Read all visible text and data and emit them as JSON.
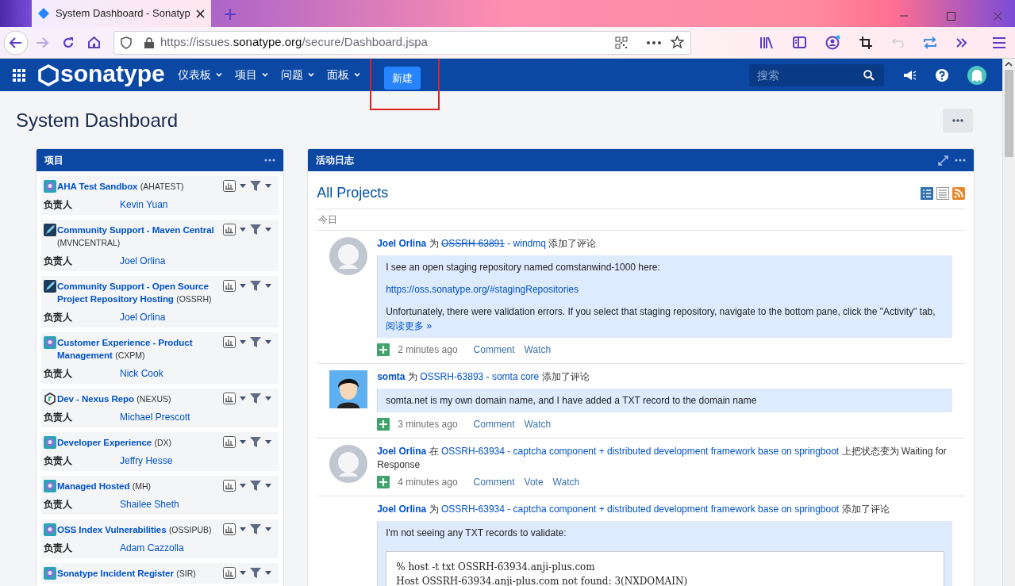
{
  "browser": {
    "tab_title": "System Dashboard - Sonatyp",
    "url": {
      "scheme": "https://issues.",
      "domain": "sonatype.org",
      "path": "/secure/Dashboard.jspa"
    }
  },
  "header": {
    "logo": "sonatype",
    "nav": [
      {
        "label": "仪表板"
      },
      {
        "label": "项目"
      },
      {
        "label": "问题"
      },
      {
        "label": "面板"
      }
    ],
    "create_button": {
      "label": "新建",
      "highlighted": true
    },
    "search": {
      "placeholder": "搜索"
    }
  },
  "page_title": "System Dashboard",
  "projects_gadget": {
    "title": "项目",
    "projects": [
      {
        "kind": "bot",
        "name": "AHA Test Sandbox",
        "key": "(AHATEST)",
        "lead_label": "负责人",
        "lead": "Kevin Yuan"
      },
      {
        "kind": "rocket",
        "name": "Community Support - Maven Central",
        "key": "(MVNCENTRAL)",
        "lead_label": "负责人",
        "lead": "Joel Orlina"
      },
      {
        "kind": "rocket",
        "name": "Community Support - Open Source Project Repository Hosting",
        "key": "(OSSRH)",
        "lead_label": "负责人",
        "lead": "Joel Orlina"
      },
      {
        "kind": "bot",
        "name": "Customer Experience - Product Management",
        "key": "(CXPM)",
        "lead_label": "负责人",
        "lead": "Nick Cook"
      },
      {
        "kind": "hexagon",
        "name": "Dev - Nexus Repo",
        "key": "(NEXUS)",
        "lead_label": "负责人",
        "lead": "Michael Prescott"
      },
      {
        "kind": "bot",
        "name": "Developer Experience",
        "key": "(DX)",
        "lead_label": "负责人",
        "lead": "Jeffry Hesse"
      },
      {
        "kind": "bot",
        "name": "Managed Hosted",
        "key": "(MH)",
        "lead_label": "负责人",
        "lead": "Shailee Sheth"
      },
      {
        "kind": "bot",
        "name": "OSS Index Vulnerabilities",
        "key": "(OSSIPUB)",
        "lead_label": "负责人",
        "lead": "Adam Cazzolla"
      },
      {
        "kind": "bot",
        "name": "Sonatype Incident Register",
        "key": "(SIR)"
      }
    ]
  },
  "activity_gadget": {
    "title": "活动日志",
    "heading": "All Projects",
    "day": "今日",
    "entries": [
      {
        "kind": "default",
        "actor": "Joel Orlina",
        "connector": "为",
        "issue_key": "OSSRH-63891",
        "resolved": true,
        "issue_summary": "- windmq",
        "action": "添加了评论",
        "comment": [
          {
            "kind": "text",
            "text": "I see an open staging repository named comstanwind-1000 here:"
          },
          {
            "kind": "link",
            "text": "https://oss.sonatype.org/#stagingRepositories"
          },
          {
            "kind": "text",
            "text": "Unfortunately, there were validation errors. If you select that staging repository, navigate to the bottom pane, click the \"Activity\" tab,"
          },
          {
            "kind": "more",
            "text": "阅读更多 »"
          }
        ],
        "time": "2 minutes ago",
        "actions": [
          "Comment",
          "Watch"
        ]
      },
      {
        "kind": "person",
        "actor": "somta",
        "connector": "为",
        "issue_key": "OSSRH-63893",
        "resolved": false,
        "issue_summary": "- somta core",
        "action": "添加了评论",
        "comment": [
          {
            "kind": "text",
            "text": "somta.net is my own domain name, and I have added a TXT record to the domain name"
          }
        ],
        "time": "3 minutes ago",
        "actions": [
          "Comment",
          "Watch"
        ]
      },
      {
        "kind": "default",
        "actor": "Joel Orlina",
        "connector": "在",
        "issue_key": "OSSRH-63934",
        "resolved": false,
        "issue_summary": "- captcha component + distributed development framework base on springboot",
        "action": "上把状态变为 Waiting for Response",
        "time": "4 minutes ago",
        "actions": [
          "Comment",
          "Vote",
          "Watch"
        ]
      },
      {
        "kind": "continuation",
        "actor": "Joel Orlina",
        "connector": "为",
        "issue_key": "OSSRH-63934",
        "resolved": false,
        "issue_summary": "- captcha component + distributed development framework base on springboot",
        "action": "添加了评论",
        "comment": [
          {
            "kind": "text",
            "text": "I'm not seeing any TXT records to validate:"
          },
          {
            "kind": "code",
            "lines": [
              "% host -t txt OSSRH-63934.anji-plus.com",
              "Host OSSRH-63934.anji-plus.com not found: 3(NXDOMAIN)"
            ]
          }
        ]
      }
    ]
  }
}
